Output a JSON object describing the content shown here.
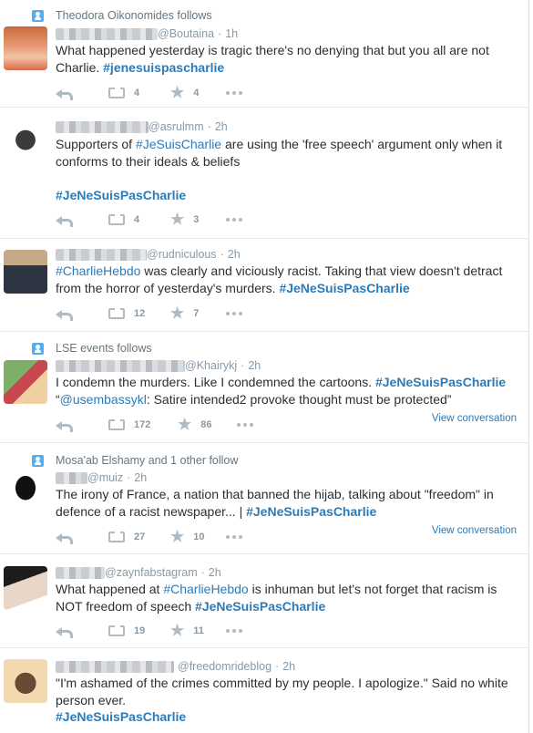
{
  "tweets": [
    {
      "context": "Theodora Oikonomides follows",
      "handle": "@Boutaina",
      "time": "1h",
      "line1": "What happened yesterday is tragic there's no denying that but you all are not",
      "line2_prefix": "Charlie. ",
      "line2_tag": "#jenesuispascharlie",
      "retweets": "4",
      "favorites": "4"
    },
    {
      "handle": "@asrulmm",
      "time": "2h",
      "line1_prefix": "Supporters of ",
      "line1_tag": "#JeSuisCharlie",
      "line1_suffix": " are using the 'free speech' argument only when it",
      "line2": "conforms to their ideals & beliefs",
      "line3_tag": "#JeNeSuisPasCharlie",
      "retweets": "4",
      "favorites": "3"
    },
    {
      "handle": "@rudniculous",
      "time": "2h",
      "line1_tag": "#CharlieHebdo",
      "line1_suffix": " was clearly and viciously racist. Taking that view doesn't detract",
      "line2_prefix": "from the horror of yesterday's murders. ",
      "line2_tag": "#JeNeSuisPasCharlie",
      "retweets": "12",
      "favorites": "7"
    },
    {
      "context": "LSE events follows",
      "handle": "@Khairykj",
      "time": "2h",
      "line1_prefix": "I condemn the murders. Like I condemned the cartoons. ",
      "line1_tag": "#JeNeSuisPasCharlie",
      "line2_quote_open": "“",
      "line2_mention": "@usembassykl",
      "line2_suffix": ": Satire intended2 provoke thought must be protected”",
      "view_conversation": "View conversation",
      "retweets": "172",
      "favorites": "86"
    },
    {
      "context": "Mosa'ab Elshamy and 1 other follow",
      "handle": "@muiz",
      "time": "2h",
      "line1": "The irony of France, a nation that banned the hijab, talking about \"freedom\" in",
      "line2_prefix": "defence of a racist newspaper... | ",
      "line2_tag": "#JeNeSuisPasCharlie",
      "view_conversation": "View conversation",
      "retweets": "27",
      "favorites": "10"
    },
    {
      "handle": "@zaynfabstagram",
      "time": "2h",
      "line1_prefix": "What happened at ",
      "line1_tag": "#CharlieHebdo",
      "line1_suffix": " is inhuman but let's not forget that racism is",
      "line2_prefix": "NOT freedom of speech ",
      "line2_tag": "#JeNeSuisPasCharlie",
      "retweets": "19",
      "favorites": "11"
    },
    {
      "handle": "@freedomrideblog",
      "time": "2h",
      "line1": "\"I'm ashamed of the crimes committed by my people. I apologize.\" Said no white",
      "line2": "person ever.",
      "line3_tag": "#JeNeSuisPasCharlie"
    }
  ],
  "separator": "·",
  "colors": {
    "link": "#2b7bb9",
    "text": "#292f33",
    "muted": "#8899a6",
    "icon": "#b0bac2",
    "context_icon": "#55acee"
  }
}
